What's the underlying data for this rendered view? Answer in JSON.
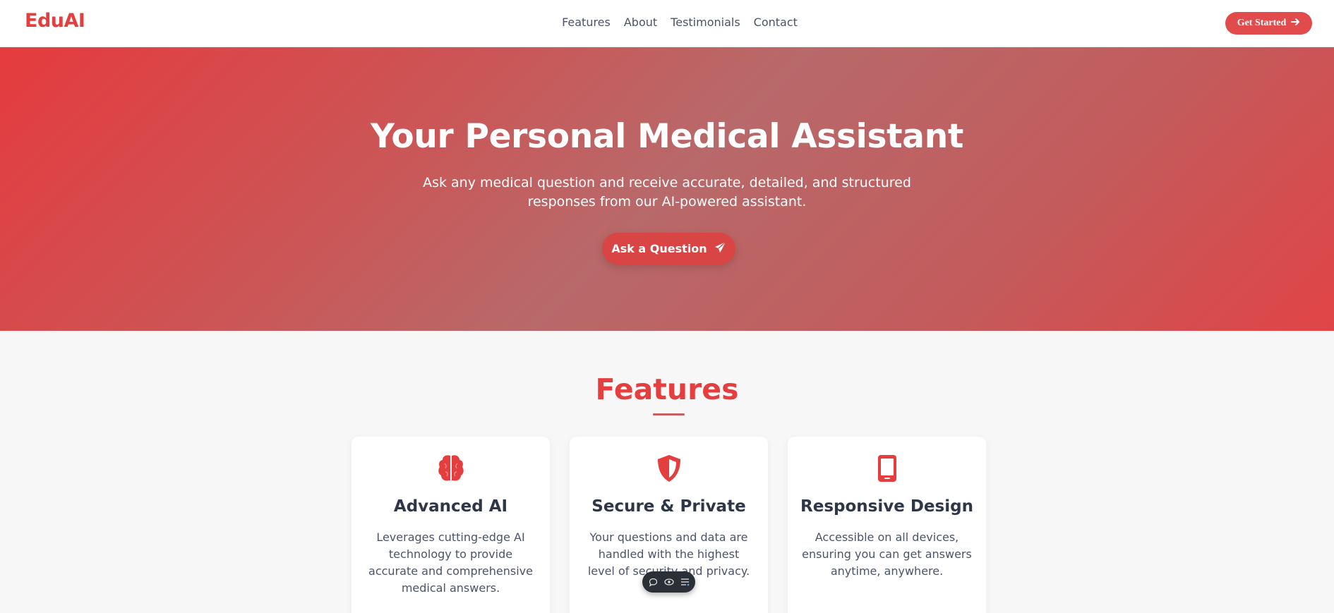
{
  "brand": {
    "name": "EduAI",
    "accent": "#e53e3e"
  },
  "nav": {
    "links": [
      "Features",
      "About",
      "Testimonials",
      "Contact"
    ],
    "cta_label": "Get Started"
  },
  "hero": {
    "title": "Your Personal Medical Assistant",
    "subtitle": "Ask any medical question and receive accurate, detailed, and structured responses from our AI-powered assistant.",
    "button_label": "Ask a Question"
  },
  "features": {
    "title": "Features",
    "cards": [
      {
        "icon": "brain-icon",
        "title": "Advanced AI",
        "description": "Leverages cutting-edge AI technology to provide accurate and comprehensive medical answers."
      },
      {
        "icon": "shield-icon",
        "title": "Secure & Private",
        "description": "Your questions and data are handled with the highest level of security and privacy."
      },
      {
        "icon": "mobile-icon",
        "title": "Responsive Design",
        "description": "Accessible on all devices, ensuring you can get answers anytime, anywhere."
      }
    ]
  },
  "floating_toolbar": {
    "icons": [
      "comment-icon",
      "eye-icon",
      "list-icon"
    ]
  }
}
